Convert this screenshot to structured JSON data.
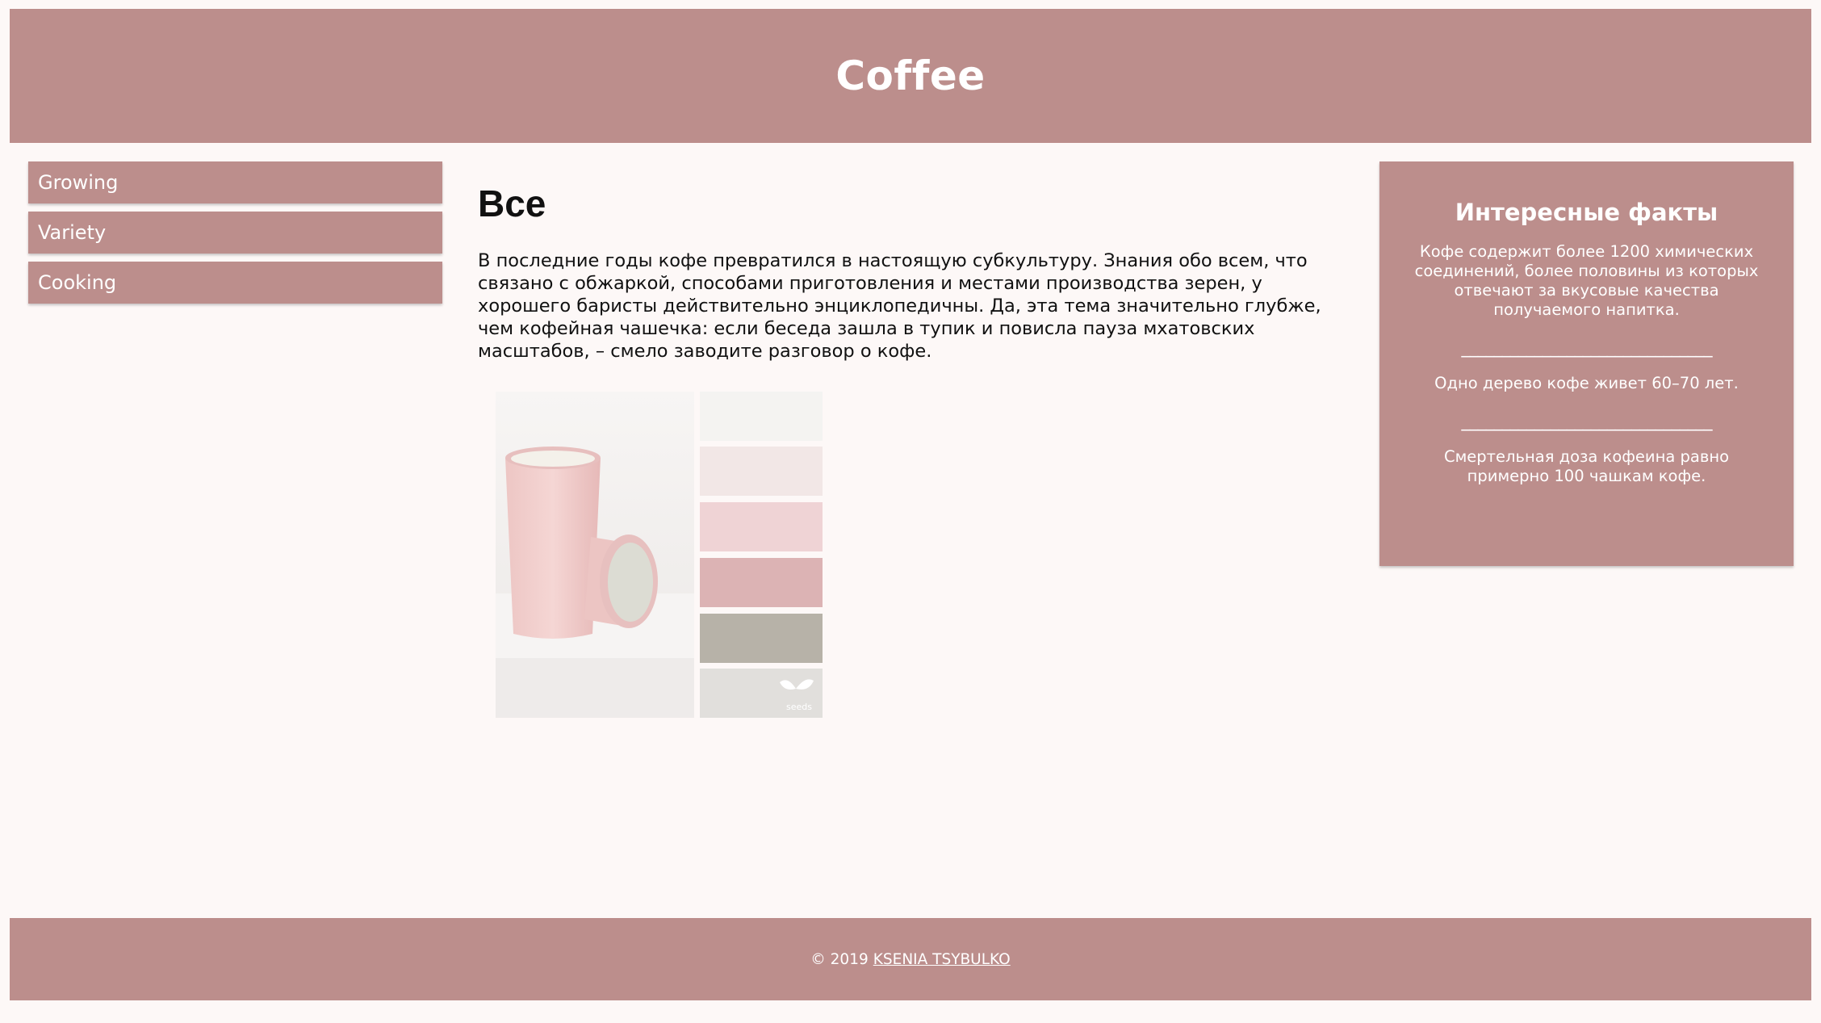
{
  "header": {
    "title": "Coffee"
  },
  "sidebar": {
    "items": [
      {
        "label": "Growing"
      },
      {
        "label": "Variety"
      },
      {
        "label": "Cooking"
      }
    ]
  },
  "main": {
    "heading": "Все",
    "intro": "В последние годы кофе превратился в настоящую субкультуру. Знания обо всем, что связано с обжаркой, способами приготовления и местами производства зерен, у хорошего баристы действительно энциклопедичны. Да, эта тема значительно глубже, чем кофейная чашечка: если беседа зашла в тупик и повисла пауза мхатовских масштабов, – смело заводите разговор о кофе.",
    "image": {
      "swatches": [
        "#f4f3f1",
        "#f2e7e6",
        "#efd3d5",
        "#dcb3b4",
        "#b7b2a8",
        "#e1dfdc"
      ],
      "watermark": "seeds"
    }
  },
  "aside": {
    "title": "Интересные факты",
    "facts": [
      "Кофе содержит более 1200 химических соединений, более половины из которых отвечают за вкусовые качества получаемого напитка.",
      "Одно дерево кофе живет 60–70 лет.",
      "Смертельная доза кофеина равно примерно 100 чашкам кофе."
    ],
    "separator": "_______________________________"
  },
  "footer": {
    "copyright": "© 2019",
    "author": "KSENIA TSYBULKO"
  },
  "colors": {
    "accent": "#bc8e8c",
    "background": "#fdf8f7",
    "text": "#111111"
  }
}
